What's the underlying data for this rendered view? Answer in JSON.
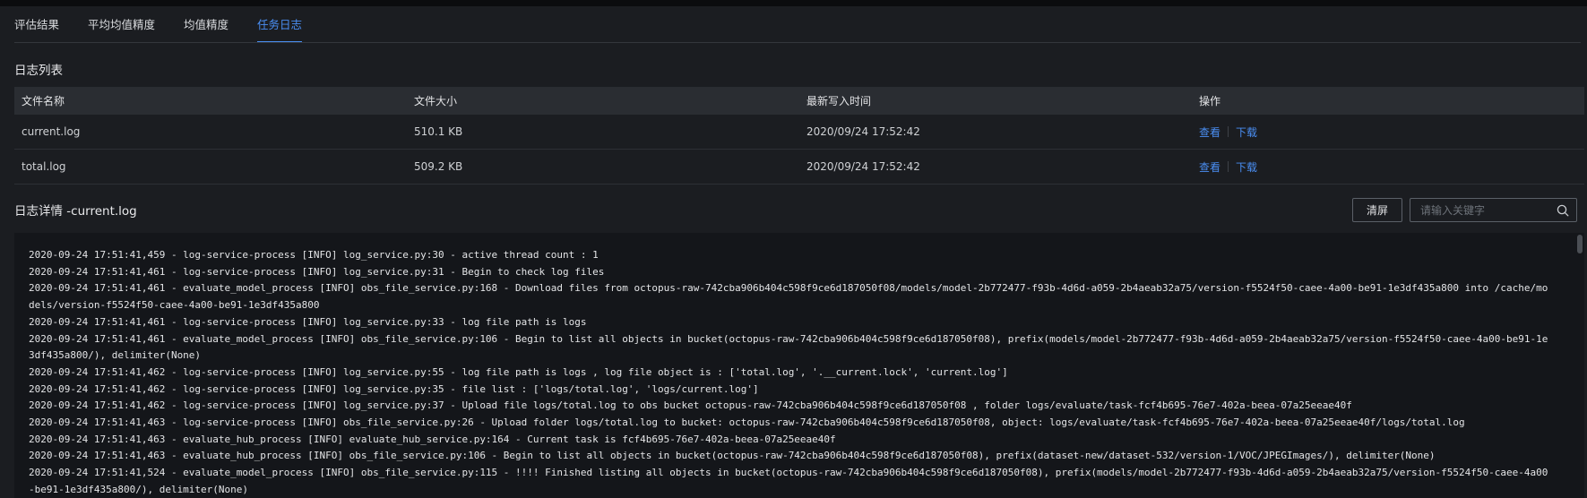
{
  "tabs": [
    {
      "label": "评估结果"
    },
    {
      "label": "平均均值精度"
    },
    {
      "label": "均值精度"
    },
    {
      "label": "任务日志",
      "active": true
    }
  ],
  "log_list": {
    "title": "日志列表",
    "columns": [
      "文件名称",
      "文件大小",
      "最新写入时间",
      "操作"
    ],
    "rows": [
      {
        "name": "current.log",
        "size": "510.1 KB",
        "time": "2020/09/24 17:52:42",
        "view": "查看",
        "download": "下载"
      },
      {
        "name": "total.log",
        "size": "509.2 KB",
        "time": "2020/09/24 17:52:42",
        "view": "查看",
        "download": "下载"
      }
    ]
  },
  "log_detail": {
    "title": "日志详情 -current.log",
    "clear_label": "清屏",
    "search_placeholder": "请输入关键字",
    "lines": [
      "2020-09-24 17:51:41,459 - log-service-process [INFO] log_service.py:30 - active thread count : 1",
      "2020-09-24 17:51:41,461 - log-service-process [INFO] log_service.py:31 - Begin to check log files",
      "2020-09-24 17:51:41,461 - evaluate_model_process [INFO] obs_file_service.py:168 - Download files from octopus-raw-742cba906b404c598f9ce6d187050f08/models/model-2b772477-f93b-4d6d-a059-2b4aeab32a75/version-f5524f50-caee-4a00-be91-1e3df435a800 into /cache/models/version-f5524f50-caee-4a00-be91-1e3df435a800",
      "2020-09-24 17:51:41,461 - log-service-process [INFO] log_service.py:33 - log file path is logs",
      "2020-09-24 17:51:41,461 - evaluate_model_process [INFO] obs_file_service.py:106 - Begin to list all objects in bucket(octopus-raw-742cba906b404c598f9ce6d187050f08), prefix(models/model-2b772477-f93b-4d6d-a059-2b4aeab32a75/version-f5524f50-caee-4a00-be91-1e3df435a800/), delimiter(None)",
      "2020-09-24 17:51:41,462 - log-service-process [INFO] log_service.py:55 - log file path is logs , log file object is : ['total.log', '.__current.lock', 'current.log']",
      "2020-09-24 17:51:41,462 - log-service-process [INFO] log_service.py:35 - file list : ['logs/total.log', 'logs/current.log']",
      "2020-09-24 17:51:41,462 - log-service-process [INFO] log_service.py:37 - Upload file logs/total.log to obs bucket octopus-raw-742cba906b404c598f9ce6d187050f08 , folder logs/evaluate/task-fcf4b695-76e7-402a-beea-07a25eeae40f",
      "2020-09-24 17:51:41,463 - log-service-process [INFO] obs_file_service.py:26 - Upload folder logs/total.log to bucket: octopus-raw-742cba906b404c598f9ce6d187050f08, object: logs/evaluate/task-fcf4b695-76e7-402a-beea-07a25eeae40f/logs/total.log",
      "2020-09-24 17:51:41,463 - evaluate_hub_process [INFO] evaluate_hub_service.py:164 - Current task is fcf4b695-76e7-402a-beea-07a25eeae40f",
      "2020-09-24 17:51:41,463 - evaluate_hub_process [INFO] obs_file_service.py:106 - Begin to list all objects in bucket(octopus-raw-742cba906b404c598f9ce6d187050f08), prefix(dataset-new/dataset-532/version-1/VOC/JPEGImages/), delimiter(None)",
      "2020-09-24 17:51:41,524 - evaluate_model_process [INFO] obs_file_service.py:115 - !!!! Finished listing all objects in bucket(octopus-raw-742cba906b404c598f9ce6d187050f08), prefix(models/model-2b772477-f93b-4d6d-a059-2b4aeab32a75/version-f5524f50-caee-4a00-be91-1e3df435a800/), delimiter(None)"
    ]
  }
}
